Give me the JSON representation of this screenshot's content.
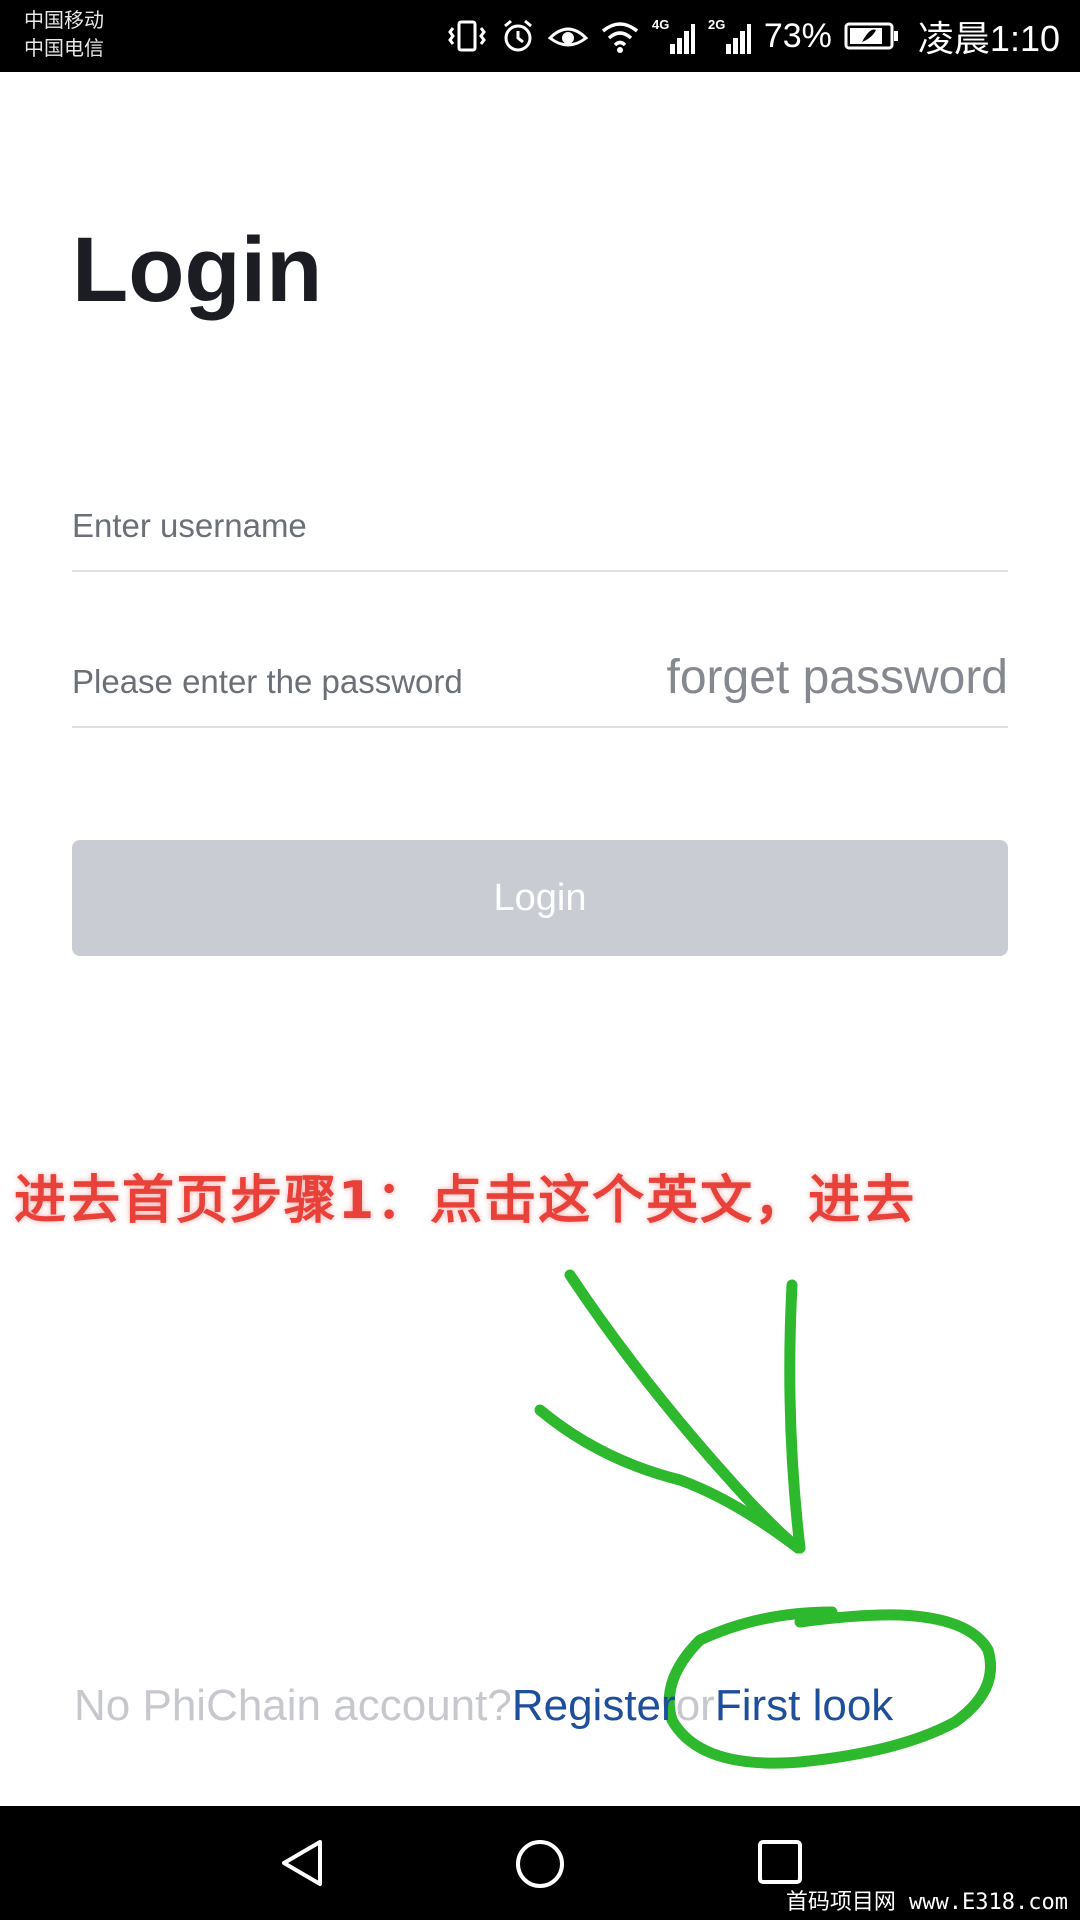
{
  "status_bar": {
    "carrier_1": "中国移动",
    "carrier_2": "中国电信",
    "network_1": "4G",
    "network_2": "2G",
    "battery_percent": "73%",
    "time": "凌晨1:10"
  },
  "login": {
    "title": "Login",
    "username_placeholder": "Enter username",
    "password_placeholder": "Please enter the password",
    "forget_password": "forget password",
    "login_button": "Login"
  },
  "annotation": {
    "text": "进去首页步骤1：点击这个英文，进去",
    "color": "#e8413a",
    "circle_color": "#2db82d"
  },
  "footer": {
    "no_account": "No PhiChain account?",
    "register": "Register",
    "or": "or",
    "first_look": "First look"
  },
  "watermark": "首码项目网 www.E318.com",
  "colors": {
    "link": "#1d4f9a",
    "button_disabled": "#c9ccd2"
  }
}
